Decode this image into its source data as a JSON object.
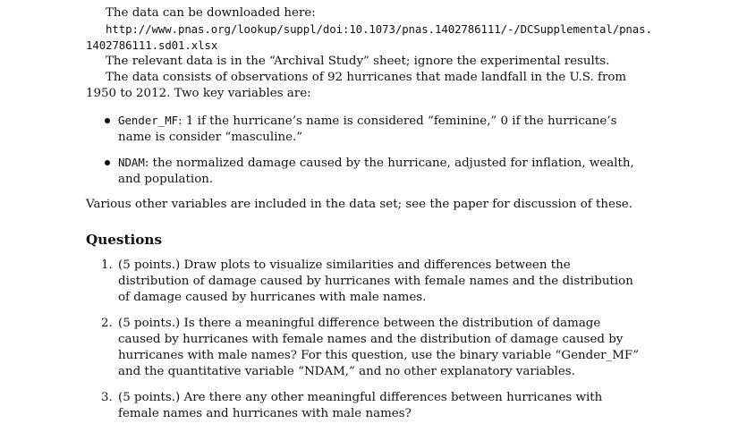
{
  "intro": {
    "download_text": "The data can be downloaded here:",
    "url_line1": "http://www.pnas.org/lookup/suppl/doi:10.1073/pnas.1402786111/-/DCSupplemental/pnas.",
    "url_line2": "1402786111.sd01.xlsx",
    "relevant_text": "The relevant data is in the “Archival Study” sheet; ignore the experimental results.",
    "consists_text": "The data consists of observations of 92 hurricanes that made landfall in the U.S. from 1950 to 2012. Two key variables are:"
  },
  "variables": [
    {
      "name": "Gender_MF",
      "description": ": 1 if the hurricane’s name is considered “feminine,” 0 if the hurricane’s name is consider “masculine.”"
    },
    {
      "name": "NDAM",
      "description": ": the normalized damage caused by the hurricane, adjusted for inflation, wealth, and population."
    }
  ],
  "other_vars_text": "Various other variables are included in the data set; see the paper for discussion of these.",
  "questions_heading": "Questions",
  "questions": [
    {
      "number": "1.",
      "text": "(5 points.) Draw plots to visualize similarities and differences between the distribution of damage caused by hurricanes with female names and the distribution of damage caused by hurricanes with male names."
    },
    {
      "number": "2.",
      "text": "(5 points.) Is there a meaningful difference between the distribution of damage caused by hurricanes with female names and the distribution of damage caused by hurricanes with male names? For this question, use the binary variable “Gender_MF” and the quantitative variable “NDAM,” and no other explanatory variables."
    },
    {
      "number": "3.",
      "text": "(5 points.) Are there any other meaningful differences between hurricanes with female names and hurricanes with male names?"
    }
  ]
}
